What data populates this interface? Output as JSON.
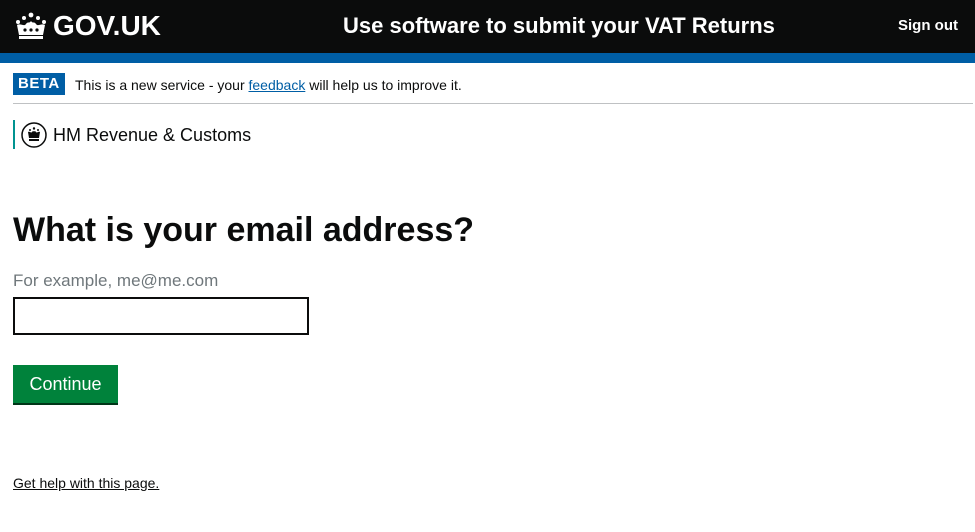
{
  "header": {
    "logo_text": "GOV.UK",
    "service_name": "Use software to submit your VAT Returns",
    "sign_out_label": "Sign out",
    "background_color": "#0b0c0c",
    "accent_bar_color": "#005ea5",
    "logo_icon": "crown-icon"
  },
  "phase_banner": {
    "tag": "BETA",
    "text_before": "This is a new service - your ",
    "link_text": "feedback",
    "text_after": " will help us to improve it."
  },
  "organisation": {
    "name": "HM Revenue & Customs",
    "icon": "crest-icon",
    "accent_color": "#009390"
  },
  "form": {
    "heading": "What is your email address?",
    "hint": "For example, me@me.com",
    "email_value": "",
    "email_placeholder": "",
    "continue_label": "Continue",
    "button_color": "#00823b"
  },
  "footer": {
    "help_link": "Get help with this page."
  }
}
